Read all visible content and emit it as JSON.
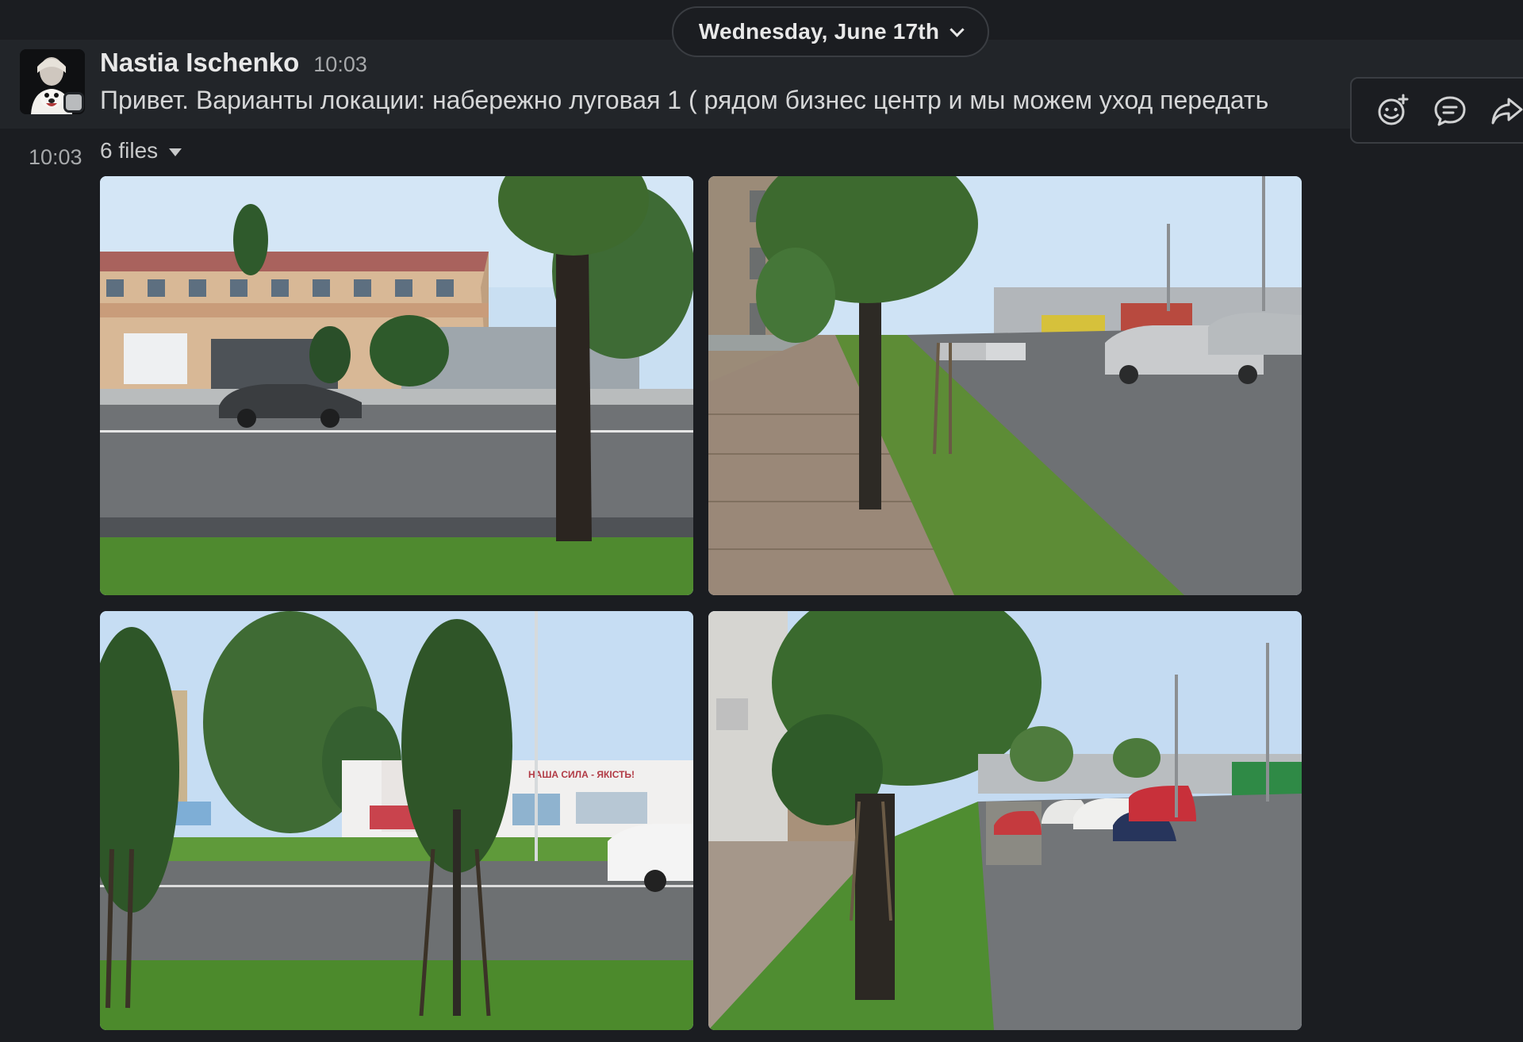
{
  "date_divider": {
    "label": "Wednesday, June 17th"
  },
  "message": {
    "sender": "Nastia Ischenko",
    "time": "10:03",
    "text": "Привет. Варианты локации: набережно луговая 1 ( рядом бизнес центр и мы можем уход передать"
  },
  "attachments": {
    "side_time": "10:03",
    "files_label": "6 files",
    "photos": [
      {
        "name": "street-photo-1",
        "subject": "building-and-road"
      },
      {
        "name": "street-photo-2",
        "subject": "sidewalk-and-traffic"
      },
      {
        "name": "street-photo-3",
        "subject": "billboard-and-trees"
      },
      {
        "name": "street-photo-4",
        "subject": "road-with-cars"
      }
    ],
    "billboard_text": "НАША СИЛА - ЯКІСТЬ!"
  },
  "toolbar": {
    "icons": [
      "add-reaction-icon",
      "reply-in-thread-icon",
      "share-message-icon"
    ]
  },
  "colors": {
    "background": "#1b1d21",
    "message_hover": "#222529",
    "border": "#3a3d42"
  }
}
